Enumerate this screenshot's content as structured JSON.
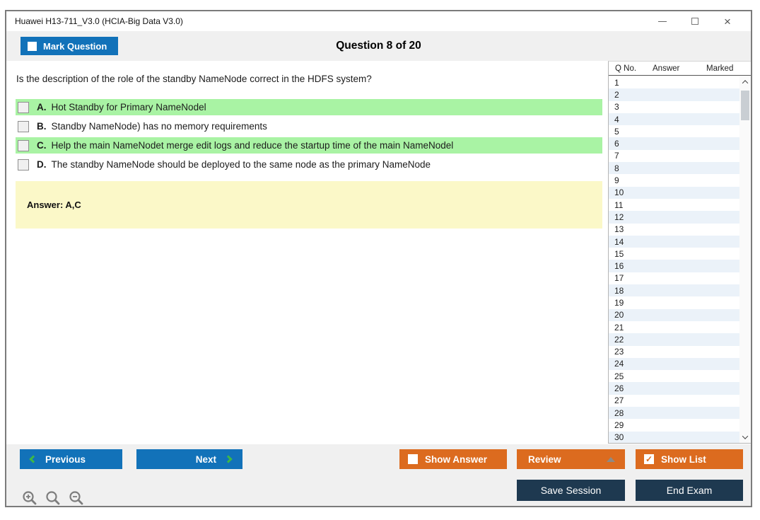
{
  "window": {
    "title": "Huawei H13-711_V3.0 (HCIA-Big Data V3.0)"
  },
  "header": {
    "mark_question": "Mark Question",
    "question_counter": "Question 8 of 20"
  },
  "question": {
    "text": "Is the description of the role of the standby NameNode correct in the HDFS system?",
    "options": [
      {
        "letter": "A.",
        "text": "Hot Standby for Primary NameNodel",
        "highlighted": true
      },
      {
        "letter": "B.",
        "text": "Standby NameNode) has no memory requirements",
        "highlighted": false
      },
      {
        "letter": "C.",
        "text": "Help the main NameNodet merge edit logs and reduce the startup time of the main NameNodel",
        "highlighted": true
      },
      {
        "letter": "D.",
        "text": "The standby NameNode should be deployed to the same node as the primary NameNode",
        "highlighted": false
      }
    ],
    "answer": "Answer: A,C"
  },
  "sidebar": {
    "columns": {
      "qno": "Q No.",
      "answer": "Answer",
      "marked": "Marked"
    },
    "rows": [
      "1",
      "2",
      "3",
      "4",
      "5",
      "6",
      "7",
      "8",
      "9",
      "10",
      "11",
      "12",
      "13",
      "14",
      "15",
      "16",
      "17",
      "18",
      "19",
      "20",
      "21",
      "22",
      "23",
      "24",
      "25",
      "26",
      "27",
      "28",
      "29",
      "30"
    ]
  },
  "footer": {
    "previous": "Previous",
    "next": "Next",
    "show_answer": "Show Answer",
    "review": "Review",
    "show_list": "Show List",
    "save_session": "Save Session",
    "end_exam": "End Exam"
  },
  "icons": {
    "check": "✓",
    "minimize_glyph": "–",
    "maximize_glyph": "□",
    "close_glyph": "×",
    "magnifier_plus": "zoom-in-magnifier",
    "magnifier": "magnifier",
    "magnifier_minus": "zoom-out-magnifier",
    "chevron_left": "green-left-chevron",
    "chevron_right": "green-right-chevron",
    "triangle_up": "collapse-triangle"
  },
  "colors": {
    "accent_blue": "#1272b9",
    "accent_orange": "#dc6b1f",
    "navy": "#1e3950",
    "highlight_green": "#a9f3a4",
    "answer_yellow": "#fbf8c8",
    "chevron_green": "#3db847",
    "alt_row_blue": "#ebf2f9",
    "strip_gray": "#f0f0f0"
  }
}
